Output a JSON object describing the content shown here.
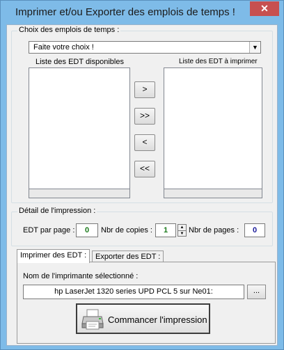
{
  "window": {
    "title": "Imprimer et/ou Exporter des emplois de temps !",
    "close_label": "✕"
  },
  "choice_group": {
    "legend": "Choix des emplois de temps :",
    "combo_value": "Faite votre choix !",
    "available_label": "Liste des EDT disponibles",
    "to_print_label": "Liste des EDT à imprimer",
    "buttons": [
      ">",
      ">>",
      "<",
      "<<"
    ]
  },
  "detail_group": {
    "legend": "Détail de l'impression :",
    "edt_per_page_label": "EDT par page :",
    "edt_per_page_value": "0",
    "copies_label": "Nbr de copies :",
    "copies_value": "1",
    "pages_label": "Nbr de pages :",
    "pages_value": "0"
  },
  "tabs": {
    "print_tab": "Imprimer des EDT :",
    "export_tab": "Exporter des EDT :"
  },
  "print_panel": {
    "printer_label": "Nom de l'imprimante sélectionné :",
    "printer_name": "hp LaserJet 1320 series UPD PCL 5 sur Ne01:",
    "browse_label": "...",
    "start_button": "Commancer l'impression"
  },
  "colors": {
    "title_bar": "#7ebbe8",
    "close_button": "#c75050",
    "edt_value": "#1a7a1a",
    "pages_value": "#1a1a9a"
  }
}
